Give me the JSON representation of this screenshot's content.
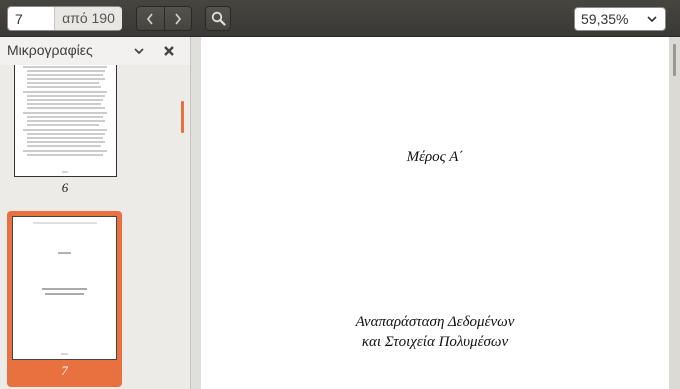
{
  "toolbar": {
    "page_current": "7",
    "page_total": "από 190",
    "prev_icon": "chevron-left-icon",
    "next_icon": "chevron-right-icon",
    "search_icon": "search-icon",
    "zoom_value": "59,35%",
    "zoom_icon": "chevron-down-icon"
  },
  "sidebar": {
    "title": "Μικρογραφίες",
    "collapse_icon": "chevron-down-icon",
    "close_icon": "close-icon",
    "thumbnails": [
      {
        "label": "6"
      },
      {
        "label": "7",
        "selected": true
      }
    ]
  },
  "document": {
    "part_title": "Μέρος Α΄",
    "subtitle_line1": "Αναπαράσταση Δεδομένων",
    "subtitle_line2": "και Στοιχεία Πολυμέσων"
  },
  "colors": {
    "accent": "#e9703f",
    "toolbar": "#3c3b37"
  }
}
